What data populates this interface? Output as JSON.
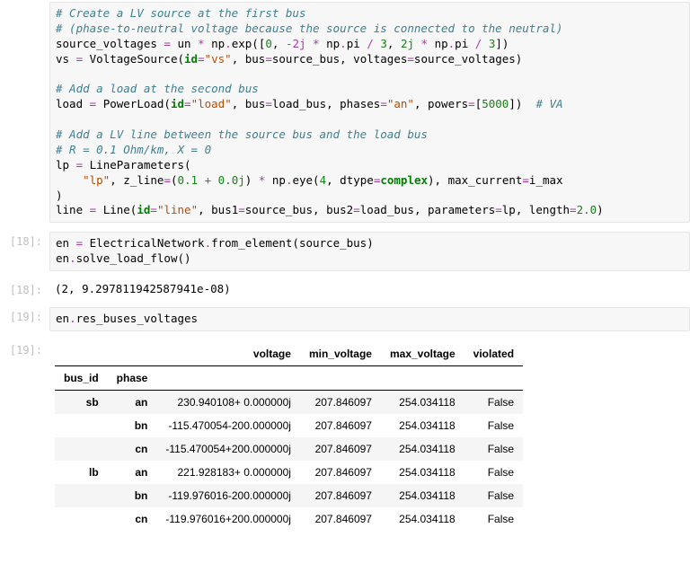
{
  "code1": {
    "comment1": "# Create a LV source at the first bus",
    "comment2": "# (phase-to-neutral voltage because the source is connected to the neutral)",
    "l3_sv": "source_voltages ",
    "l3_eq": "= ",
    "l3_un": "un ",
    "l3_mul": "* ",
    "l3_np": "np",
    "l3_dot1": ".",
    "l3_exp": "exp([",
    "l3_n0": "0",
    "l3_c1": ", ",
    "l3_neg2j": "-2j",
    "l3_mul2": " * ",
    "l3_np2": "np",
    "l3_dot2": ".",
    "l3_pi1": "pi ",
    "l3_div1": "/ ",
    "l3_n3a": "3",
    "l3_c2": ", ",
    "l3_p2j": "2j",
    "l3_mul3": " * ",
    "l3_np3": "np",
    "l3_dot3": ".",
    "l3_pi2": "pi ",
    "l3_div2": "/ ",
    "l3_n3b": "3",
    "l3_close": "])",
    "l4_vs": "vs ",
    "l4_eq": "= ",
    "l4_class": "VoltageSource(",
    "l4_kw_id": "id",
    "l4_eq2": "=",
    "l4_str": "\"vs\"",
    "l4_c1": ", bus",
    "l4_eq3": "=",
    "l4_sb": "source_bus, voltages",
    "l4_eq4": "=",
    "l4_sv": "source_voltages)",
    "comment3": "# Add a load at the second bus",
    "l6_load": "load ",
    "l6_eq": "= ",
    "l6_class": "PowerLoad(",
    "l6_kw_id": "id",
    "l6_eq2": "=",
    "l6_str": "\"load\"",
    "l6_c1": ", bus",
    "l6_eq3": "=",
    "l6_lb": "load_bus, phases",
    "l6_eq4": "=",
    "l6_str2": "\"an\"",
    "l6_c2": ", powers",
    "l6_eq5": "=",
    "l6_lb2": "[",
    "l6_num": "5000",
    "l6_rb": "])  ",
    "l6_comment": "# VA",
    "comment4": "# Add a LV line between the source bus and the load bus",
    "comment5": "# R = 0.1 Ohm/km, X = 0",
    "l9_lp": "lp ",
    "l9_eq": "= ",
    "l9_class": "LineParameters(",
    "l10_pad": "    ",
    "l10_str": "\"lp\"",
    "l10_c1": ", z_line",
    "l10_eq": "=",
    "l10_lp": "(",
    "l10_n1": "0.1",
    "l10_plus": " + ",
    "l10_n2": "0.0j",
    "l10_rp": ") ",
    "l10_mul": "* ",
    "l10_np": "np",
    "l10_dot": ".",
    "l10_eye": "eye(",
    "l10_n4": "4",
    "l10_c2": ", dtype",
    "l10_eq2": "=",
    "l10_cplx": "complex",
    "l10_rp2": "), max_current",
    "l10_eq3": "=",
    "l10_imax": "i_max",
    "l11_rp": ")",
    "l12_line": "line ",
    "l12_eq": "= ",
    "l12_class": "Line(",
    "l12_kw_id": "id",
    "l12_eq2": "=",
    "l12_str": "\"line\"",
    "l12_c1": ", bus1",
    "l12_eq3": "=",
    "l12_sb": "source_bus, bus2",
    "l12_eq4": "=",
    "l12_lb": "load_bus, parameters",
    "l12_eq5": "=",
    "l12_lp": "lp, length",
    "l12_eq6": "=",
    "l12_len": "2.0",
    "l12_rp": ")"
  },
  "prompt18": "[18]:",
  "code18": {
    "l1_en": "en ",
    "l1_eq": "= ",
    "l1_class": "ElectricalNetwork",
    "l1_dot": ".",
    "l1_from": "from_element(source_bus)",
    "l2_en": "en",
    "l2_dot": ".",
    "l2_solve": "solve_load_flow()"
  },
  "out18": "(2, 9.297811942587941e-08)",
  "prompt19": "[19]:",
  "code19": {
    "l1_en": "en",
    "l1_dot": ".",
    "l1_attr": "res_buses_voltages"
  },
  "table": {
    "columns": [
      "voltage",
      "min_voltage",
      "max_voltage",
      "violated"
    ],
    "index_names": [
      "bus_id",
      "phase"
    ],
    "rows": [
      {
        "bus": "sb",
        "phase": "an",
        "voltage": "230.940108+ 0.000000j",
        "min": "207.846097",
        "max": "254.034118",
        "viol": "False"
      },
      {
        "bus": "",
        "phase": "bn",
        "voltage": "-115.470054-200.000000j",
        "min": "207.846097",
        "max": "254.034118",
        "viol": "False"
      },
      {
        "bus": "",
        "phase": "cn",
        "voltage": "-115.470054+200.000000j",
        "min": "207.846097",
        "max": "254.034118",
        "viol": "False"
      },
      {
        "bus": "lb",
        "phase": "an",
        "voltage": "221.928183+ 0.000000j",
        "min": "207.846097",
        "max": "254.034118",
        "viol": "False"
      },
      {
        "bus": "",
        "phase": "bn",
        "voltage": "-119.976016-200.000000j",
        "min": "207.846097",
        "max": "254.034118",
        "viol": "False"
      },
      {
        "bus": "",
        "phase": "cn",
        "voltage": "-119.976016+200.000000j",
        "min": "207.846097",
        "max": "254.034118",
        "viol": "False"
      }
    ]
  }
}
